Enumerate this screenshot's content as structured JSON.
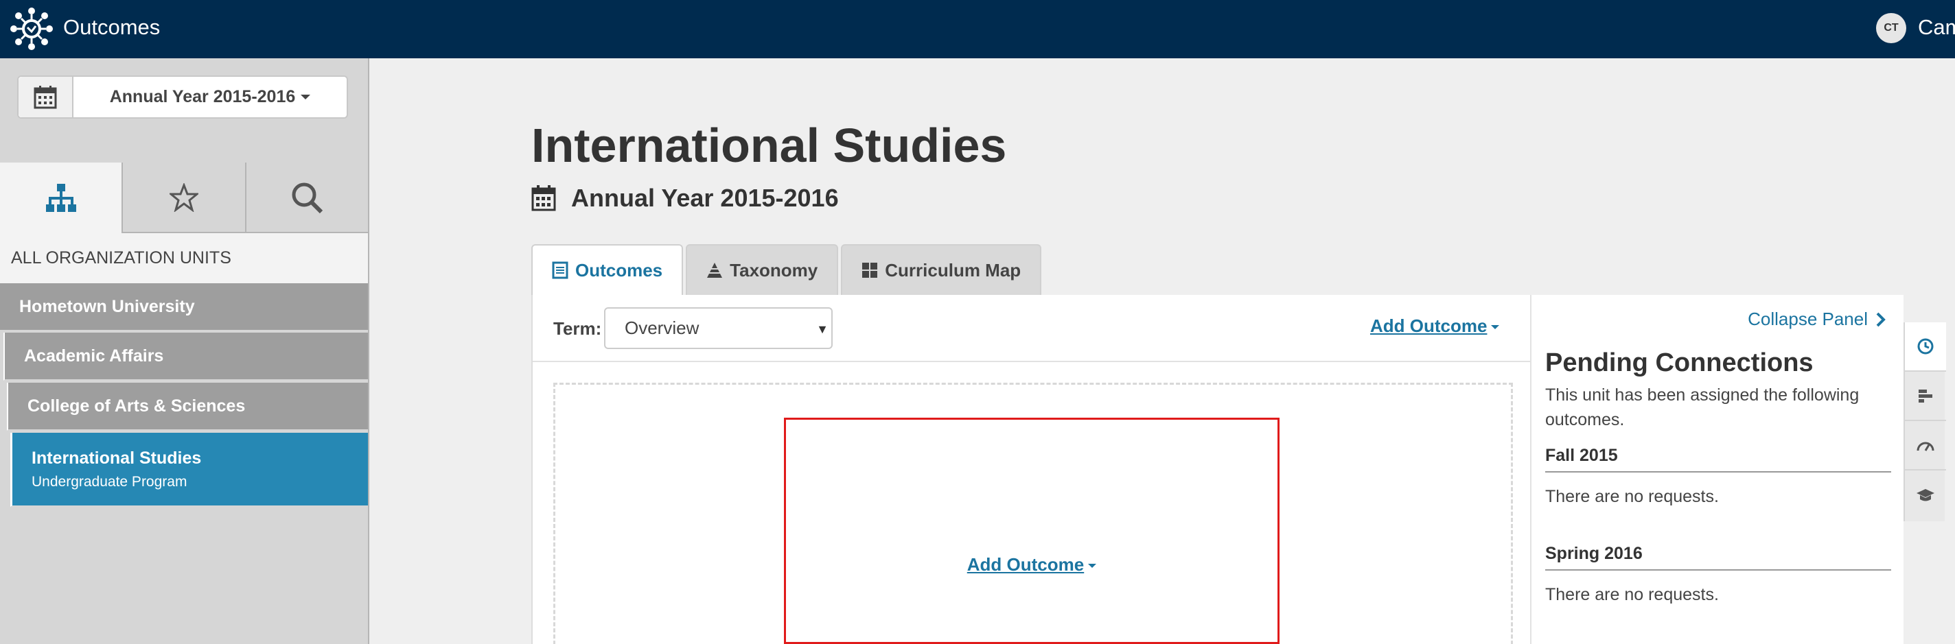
{
  "header": {
    "app_title": "Outcomes",
    "user_initials": "CT",
    "user_name": "Cam"
  },
  "sidebar": {
    "year_selector": "Annual Year 2015-2016",
    "tabs": [
      "hierarchy-icon",
      "star-icon",
      "search-icon"
    ],
    "org_units_label": "ALL ORGANIZATION UNITS",
    "tree": [
      {
        "label": "Hometown University"
      },
      {
        "label": "Academic Affairs"
      },
      {
        "label": "College of Arts & Sciences"
      },
      {
        "label": "International Studies",
        "sublabel": "Undergraduate Program"
      }
    ]
  },
  "main": {
    "title": "International Studies",
    "subtitle": "Annual Year 2015-2016",
    "tabs": [
      {
        "label": "Outcomes",
        "icon": "list-icon"
      },
      {
        "label": "Taxonomy",
        "icon": "pyramid-icon"
      },
      {
        "label": "Curriculum Map",
        "icon": "grid-icon"
      }
    ],
    "term_label": "Term:",
    "term_value": "Overview",
    "add_outcome_label": "Add Outcome",
    "center_add_outcome_label": "Add Outcome"
  },
  "pending": {
    "collapse_label": "Collapse Panel",
    "title": "Pending Connections",
    "description": "This unit has been assigned the following outcomes.",
    "terms": [
      {
        "name": "Fall 2015",
        "message": "There are no requests."
      },
      {
        "name": "Spring 2016",
        "message": "There are no requests."
      }
    ]
  },
  "colors": {
    "topbar": "#002b4f",
    "accent": "#1b74a0",
    "active_tree": "#2688b4",
    "highlight": "#e01b1b"
  }
}
